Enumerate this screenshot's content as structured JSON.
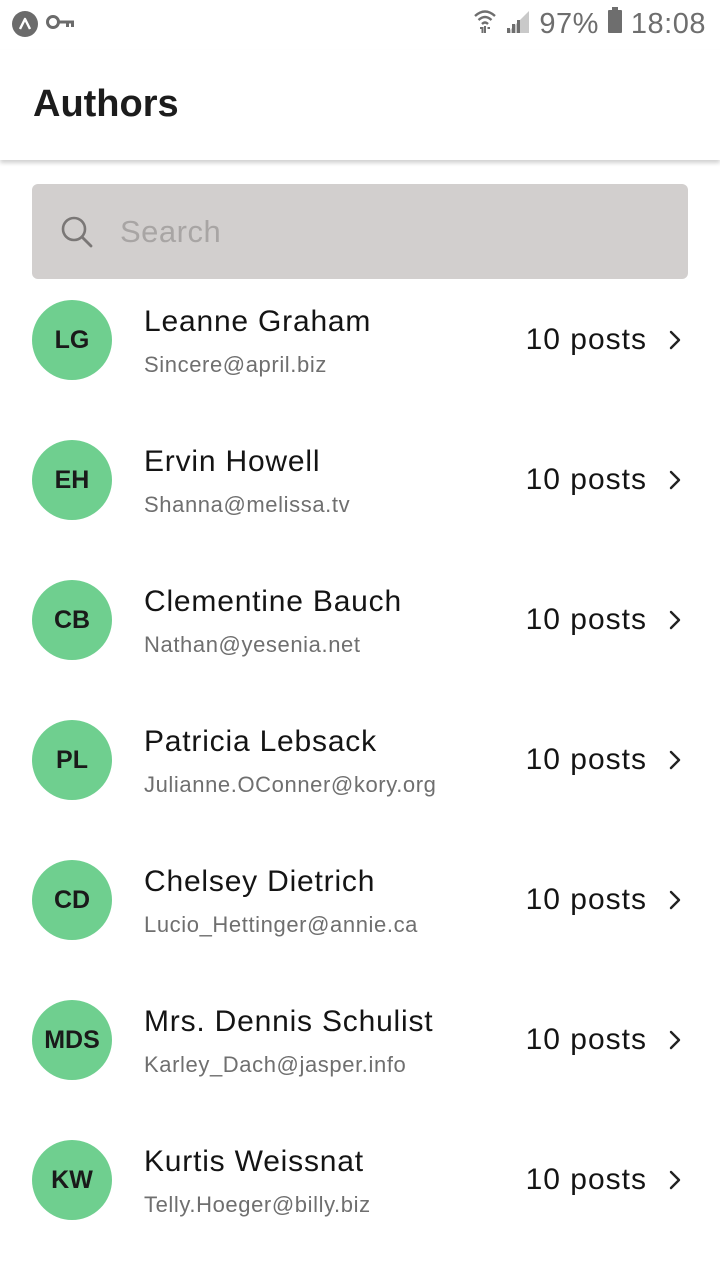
{
  "status_bar": {
    "battery": "97%",
    "time": "18:08",
    "icons": [
      "app-circle-icon",
      "key-icon",
      "wifi-icon",
      "signal-icon",
      "battery-icon"
    ]
  },
  "app_bar": {
    "title": "Authors"
  },
  "search": {
    "placeholder": "Search",
    "value": ""
  },
  "colors": {
    "avatar_bg": "#6fcf8f",
    "search_bg": "#d2cfce"
  },
  "authors": [
    {
      "initials": "LG",
      "name": "Leanne Graham",
      "email": "Sincere@april.biz",
      "posts": "10 posts"
    },
    {
      "initials": "EH",
      "name": "Ervin Howell",
      "email": "Shanna@melissa.tv",
      "posts": "10 posts"
    },
    {
      "initials": "CB",
      "name": "Clementine Bauch",
      "email": "Nathan@yesenia.net",
      "posts": "10 posts"
    },
    {
      "initials": "PL",
      "name": "Patricia Lebsack",
      "email": "Julianne.OConner@kory.org",
      "posts": "10 posts"
    },
    {
      "initials": "CD",
      "name": "Chelsey Dietrich",
      "email": "Lucio_Hettinger@annie.ca",
      "posts": "10 posts"
    },
    {
      "initials": "MDS",
      "name": "Mrs. Dennis Schulist",
      "email": "Karley_Dach@jasper.info",
      "posts": "10 posts"
    },
    {
      "initials": "KW",
      "name": "Kurtis Weissnat",
      "email": "Telly.Hoeger@billy.biz",
      "posts": "10 posts"
    }
  ]
}
